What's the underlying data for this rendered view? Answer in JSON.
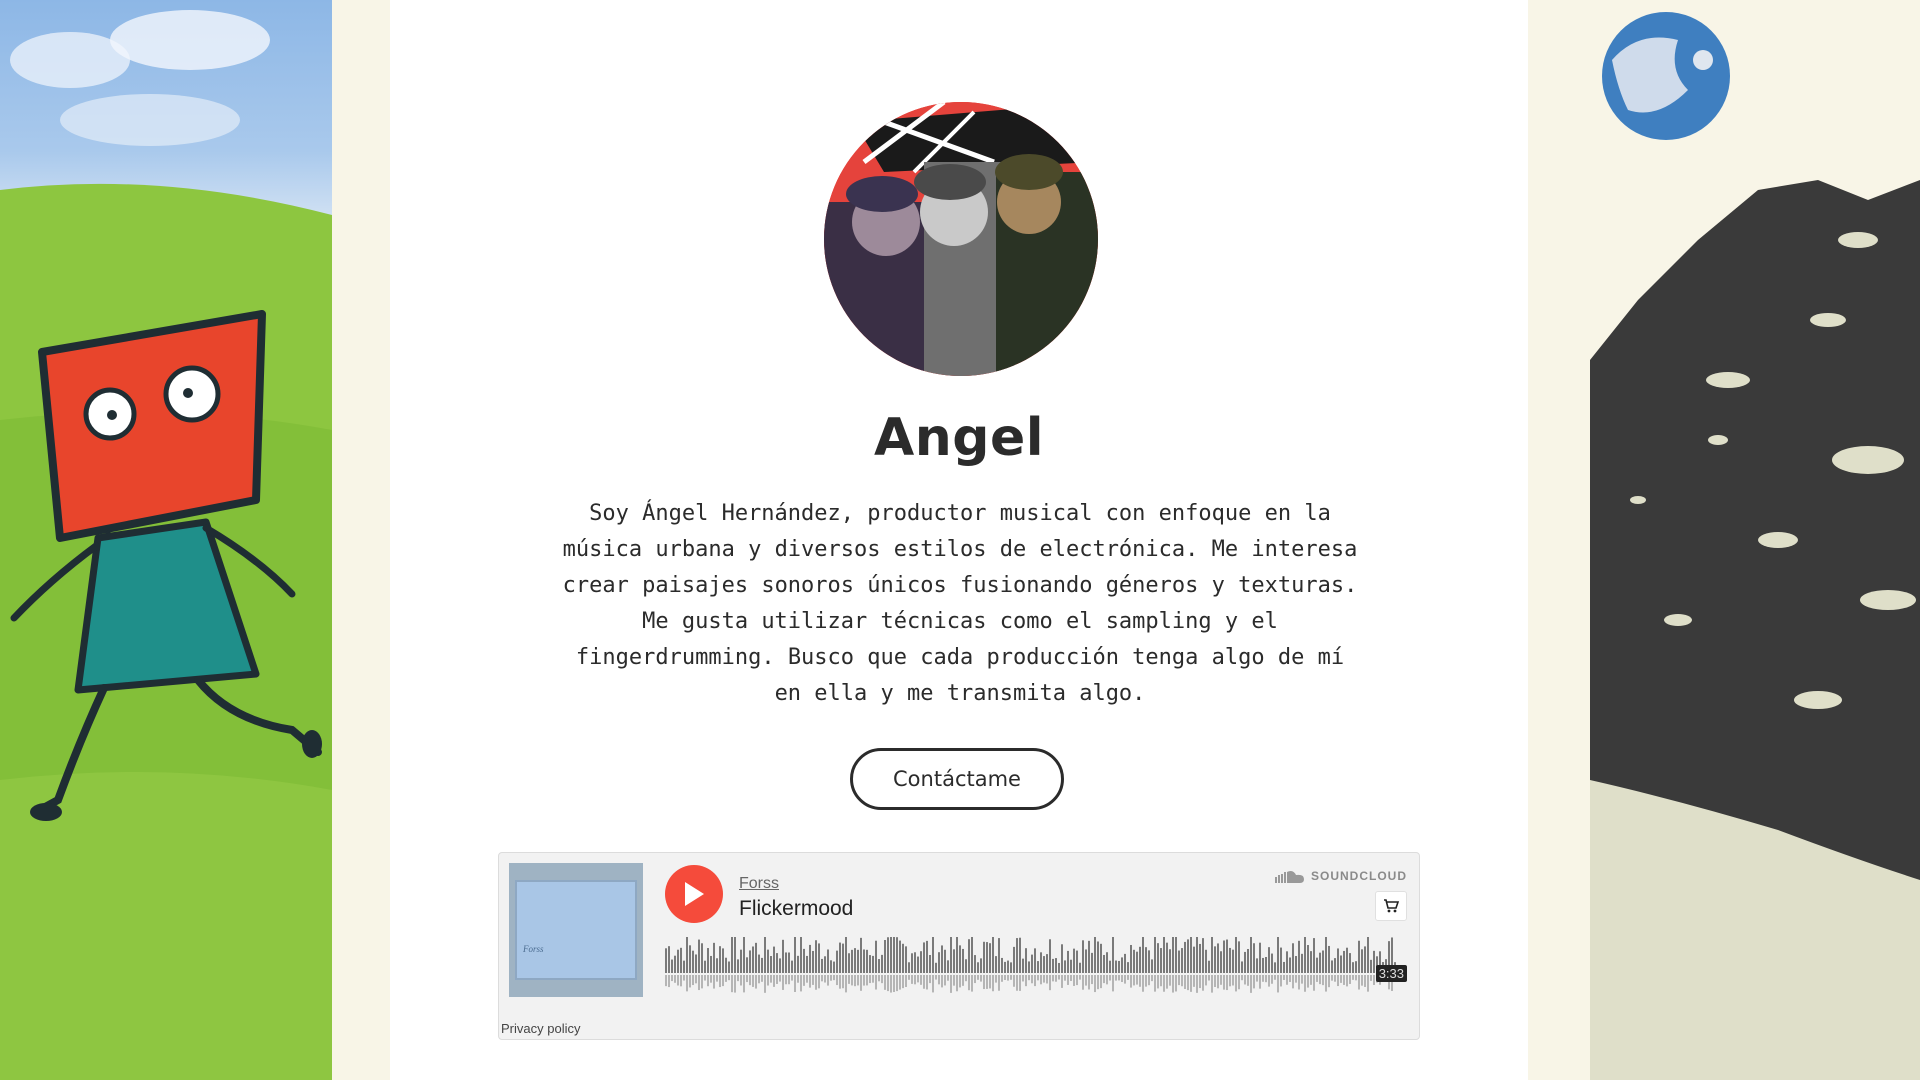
{
  "profile": {
    "name": "Angel",
    "bio": "Soy Ángel Hernández, productor musical con enfoque en la música urbana y diversos estilos de electrónica. Me interesa crear paisajes sonoros únicos fusionando géneros y texturas. Me gusta utilizar técnicas como el sampling y el fingerdrumming. Busco que cada producción tenga algo de mí en ella y me transmita algo.",
    "contact_label": "Contáctame"
  },
  "player": {
    "artist": "Forss",
    "track": "Flickermood",
    "brand": "SOUNDCLOUD",
    "duration": "3:33",
    "privacy": "Privacy policy",
    "icons": {
      "play": "play-icon",
      "brand": "soundcloud-cloud-icon",
      "cart": "cart-icon"
    },
    "colors": {
      "accent": "#f54b3b",
      "waveform": "#8a8a8a"
    }
  },
  "colors": {
    "page_bg": "#f8f5e7",
    "content_bg": "#ffffff",
    "text": "#2b2b2b"
  }
}
